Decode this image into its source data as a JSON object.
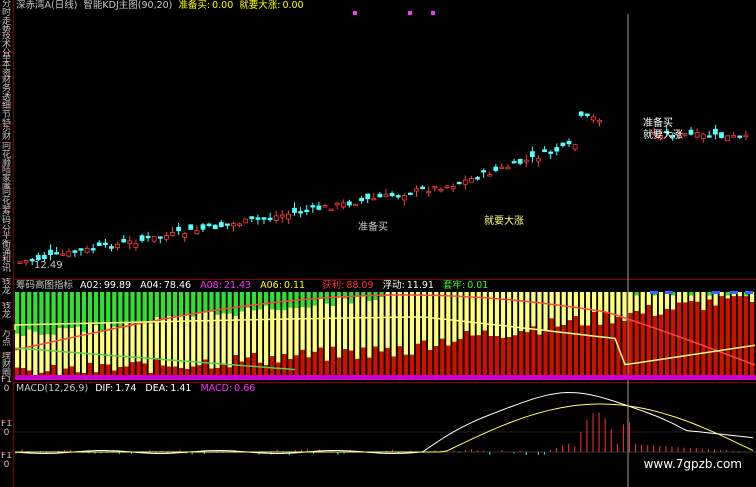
{
  "sidebar": {
    "tabs": [
      "分时走势",
      "技术分析",
      "基本资料",
      "财务透视",
      "细节特惠",
      "东财",
      "同花顺",
      "陆家嘴",
      "同花顺",
      "筹码分布",
      "平衡通道",
      "和讯",
      "钱龙",
      "钱龙",
      "万点",
      "理财圈",
      "F10",
      "F10",
      "F10"
    ]
  },
  "main_header": {
    "symbol": "深赤湾A(日线)",
    "indicator": "智能KDJ主图(90,20)",
    "buy_label": "准备买:",
    "buy_value": "0.00",
    "rise_label": "就要大涨:",
    "rise_value": "0.00"
  },
  "price_chart": {
    "low_price_label": "12.49",
    "annotation_lower_1": "准备买",
    "annotation_lower_2": "就要大涨",
    "annotation_upper_1": "准备买",
    "annotation_upper_2": "就要大涨"
  },
  "chip_header": {
    "title": "筹码高图指标",
    "a02_label": "A02:",
    "a02_value": "99.89",
    "a04_label": "A04:",
    "a04_value": "78.46",
    "a08_label": "A08:",
    "a08_value": "21.43",
    "a06_label": "A06:",
    "a06_value": "0.11",
    "profit_label": "获利:",
    "profit_value": "88.09",
    "float_label": "浮动:",
    "float_value": "11.91",
    "trap_label": "套牢:",
    "trap_value": "0.01"
  },
  "macd_header": {
    "title": "MACD(12,26,9)",
    "dif_label": "DIF:",
    "dif_value": "1.74",
    "dea_label": "DEA:",
    "dea_value": "1.41",
    "macd_label": "MACD:",
    "macd_value": "0.66"
  },
  "watermark": "www.7gpzb.com",
  "colors": {
    "up": "#ff3c3c",
    "down": "#54ffff",
    "profit_bar": "#cc1100",
    "float_bar": "#ffff80",
    "trap_bar": "#33dd33",
    "grid": "#8a0000",
    "magenta": "#ff33ff",
    "yellow_text": "#ffff00"
  }
}
